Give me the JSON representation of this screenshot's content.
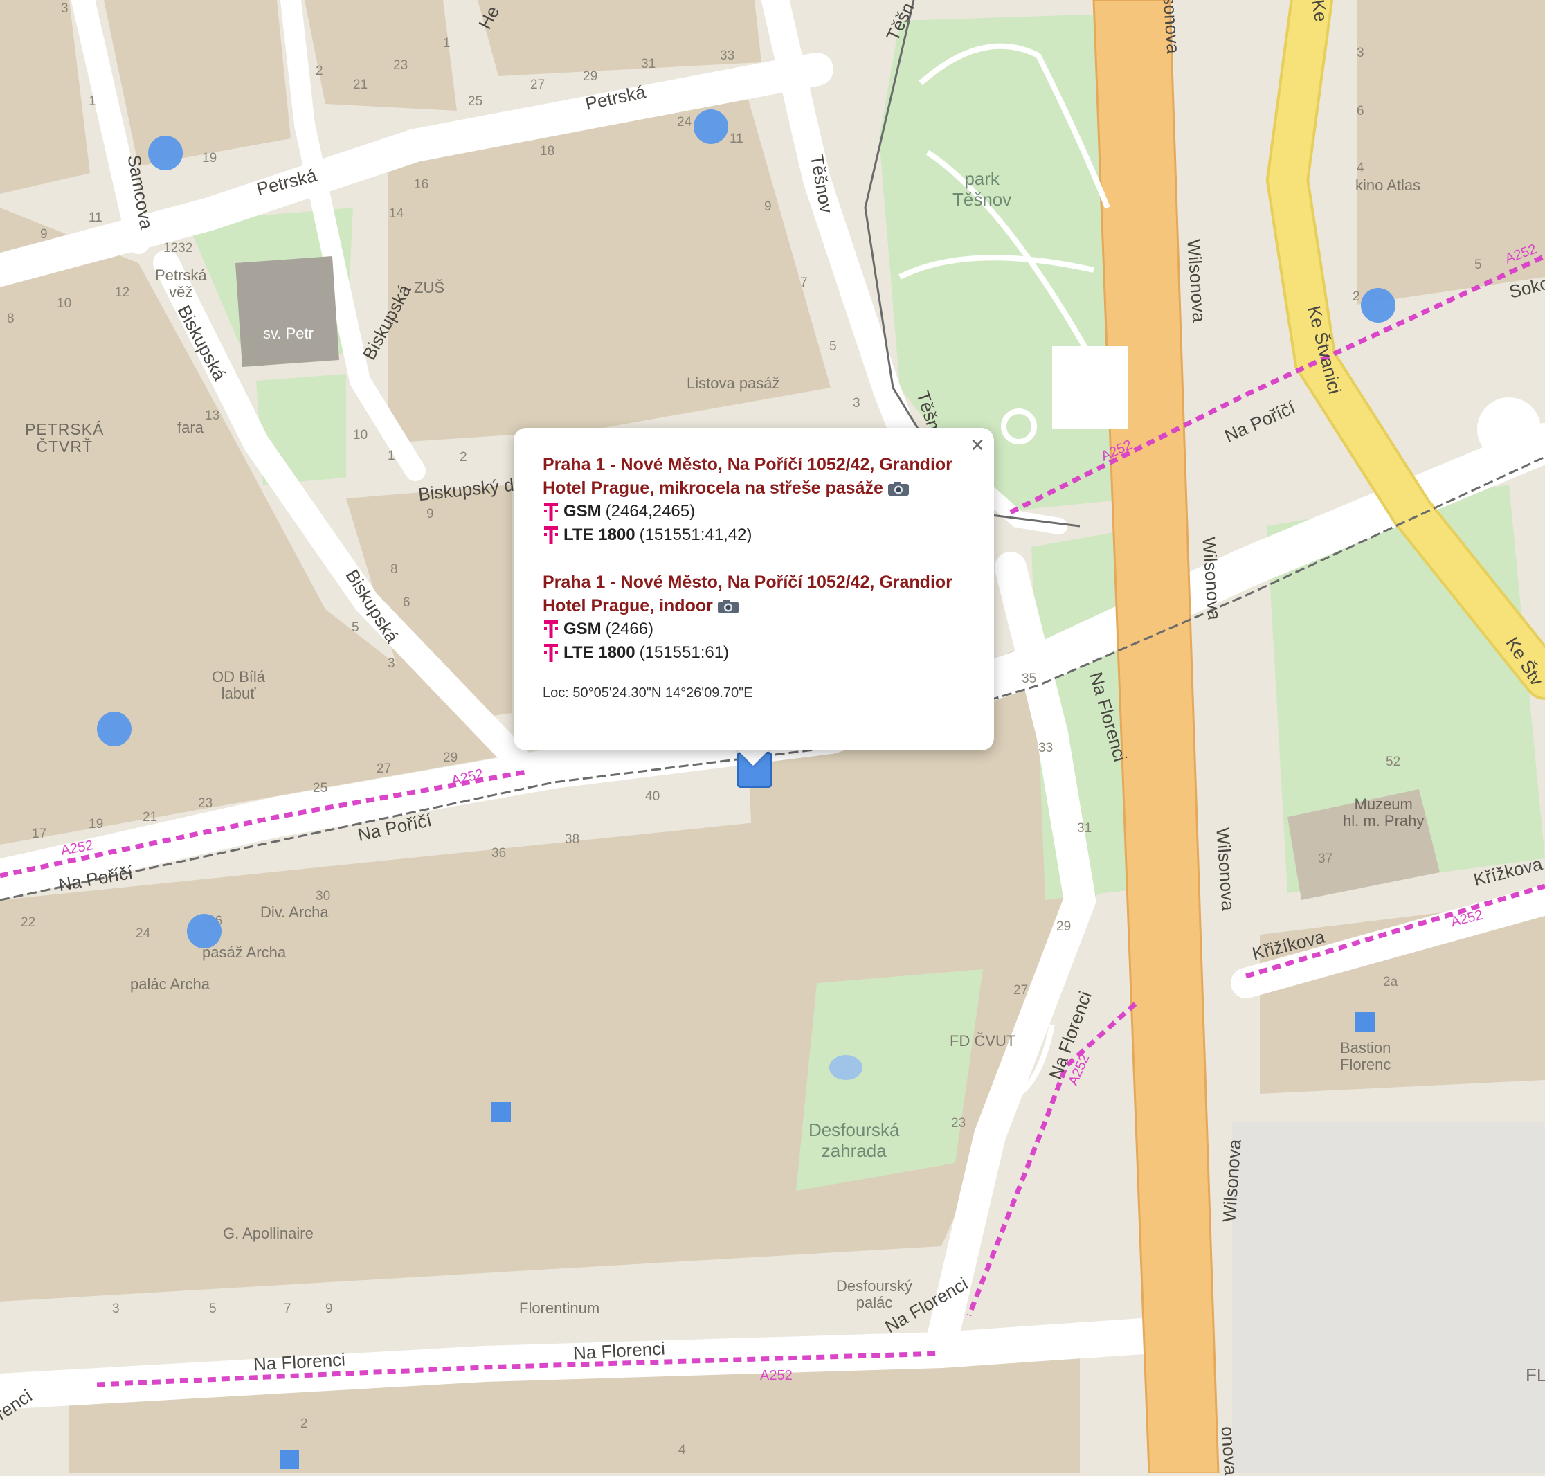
{
  "map": {
    "streets": {
      "petrska_1": "Petrská",
      "petrska_2": "Petrská",
      "samcova": "Samcova",
      "biskupska_1": "Biskupská",
      "biskupska_2": "Biskupská",
      "biskupska_3": "Biskupská",
      "biskupsky_dvur": "Biskupský d",
      "na_porici_1": "Na Poříčí",
      "na_porici_2": "Na Poříčí",
      "na_porici_3": "Na Poříčí",
      "tesnov_1": "Těšnov",
      "tesnov_2": "Těšn",
      "tesnov_top": "Těšn",
      "wilsonova_1": "Wilsonova",
      "wilsonova_2": "Wilsonova",
      "wilsonova_3": "Wilsonova",
      "wilsonova_4": "Wilsonova",
      "wilsonova_top": "sonova",
      "wilsonova_bottom": "onova",
      "wilsonova_left": "onova",
      "ke_stvanici_1": "Ke Štvanici",
      "ke_stvanici_2": "Ke Štv",
      "ke_top": "Ke",
      "soko": "Soko",
      "na_florenci_1": "Na Florenci",
      "na_florenci_2": "Na Florenci",
      "na_florenci_3": "Na Florenci",
      "na_florenci_4": "Na Florenci",
      "na_florenci_5": "Na Florenci",
      "na_florenci_left": "renci",
      "krizikova_1": "Křižíkova",
      "krizikova_2": "Křížkova",
      "he": "He"
    },
    "places": {
      "park_tesnov": "park\nTěšnov",
      "kino_atlas": "kino Atlas",
      "petrska_vez": "Petrská\nvěž",
      "sv_petr": "sv. Petr",
      "zus": "ZUŠ",
      "listova_pasaz": "Listova pasáž",
      "petrska_ctvrt": "PETRSKÁ\nČTVRŤ",
      "fara": "fara",
      "od_bila_labut": "OD Bílá\nlabuť",
      "div_archa": "Div. Archa",
      "pasaz_archa": "pasáž Archa",
      "palac_archa": "palác Archa",
      "muzeum": "Muzeum\nhl. m. Prahy",
      "fd_cvut": "FD ČVUT",
      "bastion": "Bastion\nFlorenc",
      "desfourska_zahrada": "Desfourská\nzahrada",
      "desfoursky_palac": "Desfourský\npalác",
      "g_apollinaire": "G. Apollinaire",
      "florentinum": "Florentinum",
      "fl": "FL"
    },
    "route_labels": [
      "A252",
      "A252",
      "A252",
      "A252",
      "A252",
      "A252",
      "A252",
      "A252"
    ],
    "house_numbers": [
      "3",
      "1",
      "2",
      "23",
      "21",
      "25",
      "27",
      "29",
      "31",
      "33",
      "24",
      "11",
      "18",
      "19",
      "16",
      "14",
      "9",
      "1",
      "11",
      "9",
      "1232",
      "12",
      "10",
      "8",
      "13",
      "10",
      "1",
      "2",
      "9",
      "8",
      "6",
      "5",
      "3",
      "27",
      "29",
      "25",
      "23",
      "19",
      "21",
      "17",
      "36",
      "38",
      "40",
      "30",
      "24",
      "22",
      "26",
      "7",
      "5",
      "3",
      "35",
      "33",
      "31",
      "29",
      "27",
      "23",
      "52",
      "37",
      "2a",
      "5",
      "2",
      "6",
      "4",
      "3",
      "3",
      "5",
      "7",
      "9",
      "4",
      "2"
    ]
  },
  "popup": {
    "close": "×",
    "sites": [
      {
        "title": "Praha 1 - Nové Město, Na Poříčí 1052/42, Grandior Hotel Prague, mikrocela na střeše pasáže",
        "techs": [
          {
            "name": "GSM",
            "ids": "(2464,2465)"
          },
          {
            "name": "LTE 1800",
            "ids": "(151551:41,42)"
          }
        ]
      },
      {
        "title": "Praha 1 - Nové Město, Na Poříčí 1052/42, Grandior Hotel Prague, indoor",
        "techs": [
          {
            "name": "GSM",
            "ids": "(2466)"
          },
          {
            "name": "LTE 1800",
            "ids": "(151551:61)"
          }
        ]
      }
    ],
    "location": "Loc: 50°05'24.30\"N 14°26'09.70\"E"
  },
  "colors": {
    "building": "#dbcfb9",
    "road": "#ffffff",
    "park": "#cfe8c2",
    "major_road": "#f5c57c",
    "yellow_road": "#f7e27a",
    "cycle_route": "#d946c8",
    "marker": "#4f8fe6",
    "site_title": "#8b1a1a",
    "telekom": "#e20074"
  }
}
